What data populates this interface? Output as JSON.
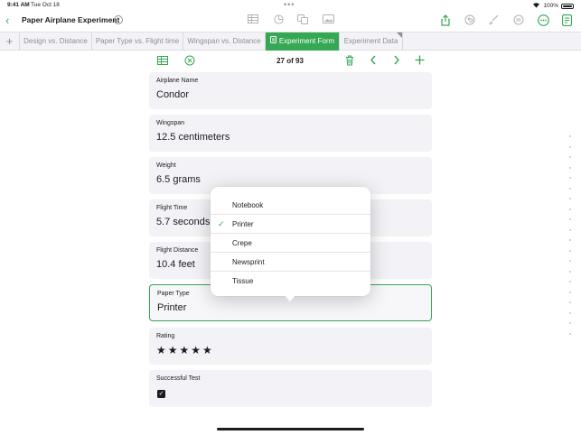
{
  "status_bar": {
    "time": "9:41 AM",
    "date": "Tue Oct 18",
    "battery": "100%"
  },
  "toolbar": {
    "title": "Paper Airplane Experiment"
  },
  "tabs": [
    {
      "label": "Design vs. Distance"
    },
    {
      "label": "Paper Type vs. Flight time"
    },
    {
      "label": "Wingspan vs. Distance"
    },
    {
      "label": "Experiment Form"
    },
    {
      "label": "Experiment Data"
    }
  ],
  "record_nav": {
    "counter": "27 of 93"
  },
  "fields": [
    {
      "label": "Airplane Name",
      "value": "Condor"
    },
    {
      "label": "Wingspan",
      "value": "12.5 centimeters"
    },
    {
      "label": "Weight",
      "value": "6.5 grams"
    },
    {
      "label": "Flight Time",
      "value": "5.7 seconds"
    },
    {
      "label": "Flight Distance",
      "value": "10.4 feet"
    },
    {
      "label": "Paper Type",
      "value": "Printer"
    },
    {
      "label": "Rating",
      "value": "★★★★★"
    },
    {
      "label": "Successful Test"
    }
  ],
  "popover": {
    "options": [
      "Notebook",
      "Printer",
      "Crepe",
      "Newsprint",
      "Tissue"
    ]
  },
  "colors": {
    "accent": "#34a853"
  }
}
